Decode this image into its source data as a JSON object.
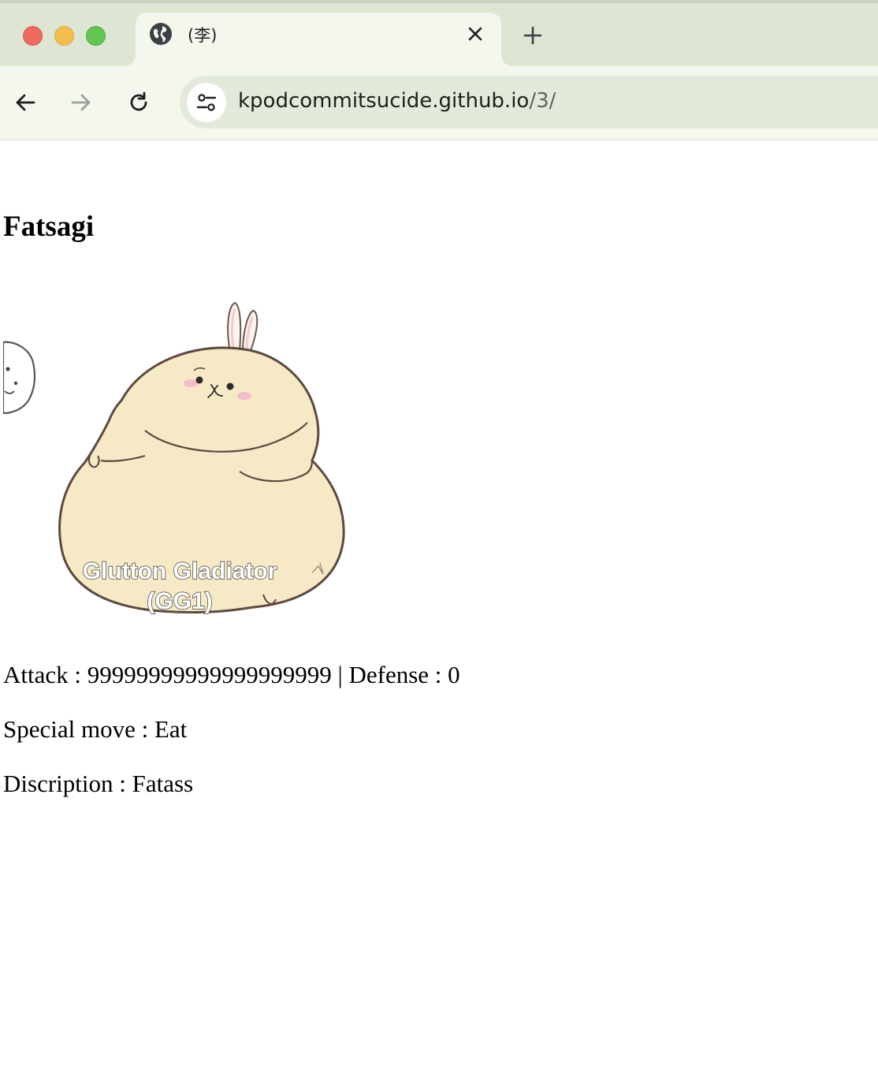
{
  "browser": {
    "tab": {
      "title": "(李)"
    },
    "url": {
      "host": "kpodcommitsucide.github.io",
      "path": "/3/"
    }
  },
  "page": {
    "heading": "Fatsagi",
    "image": {
      "caption_line1": "Glutton Gladiator",
      "caption_line2": "(GG1)"
    },
    "stats": {
      "attack_label": "Attack : ",
      "attack_value": "99999999999999999999",
      "separator": " | ",
      "defense_label": "Defense : ",
      "defense_value": "0"
    },
    "special": {
      "label": "Special move : ",
      "value": "Eat"
    },
    "description": {
      "label": "Discription : ",
      "value": "Fatass"
    }
  },
  "colors": {
    "tabstrip": "#dce6d3",
    "active_tab": "#f4f7ee",
    "omnibox": "#e3eadb",
    "creature_body": "#f6e9c6"
  }
}
